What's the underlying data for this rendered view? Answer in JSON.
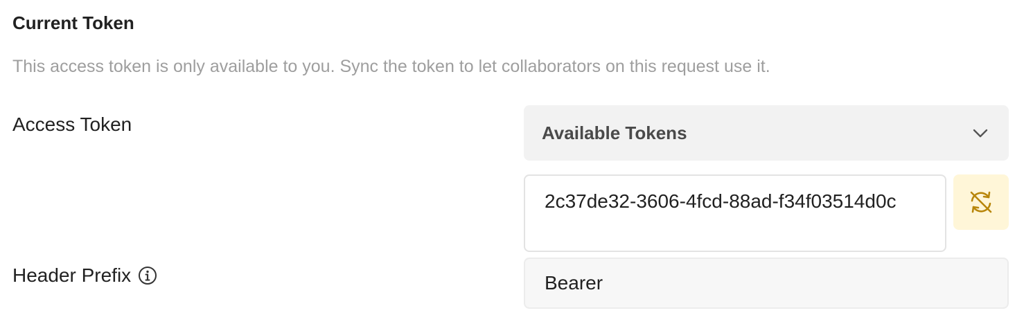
{
  "section": {
    "title": "Current Token",
    "description": "This access token is only available to you. Sync the token to let collaborators on this request use it."
  },
  "access_token": {
    "label": "Access Token",
    "dropdown_label": "Available Tokens",
    "dropdown_icon": "chevron-down-icon",
    "value": "2c37de32-3606-4fcd-88ad-f34f03514d0c",
    "sync_icon": "sync-off-icon"
  },
  "header_prefix": {
    "label": "Header Prefix",
    "info_icon": "info-icon",
    "value": "Bearer"
  },
  "colors": {
    "sync_button_bg": "#fff6d8",
    "sync_icon": "#b8860b",
    "description_text": "#9e9e9e"
  }
}
